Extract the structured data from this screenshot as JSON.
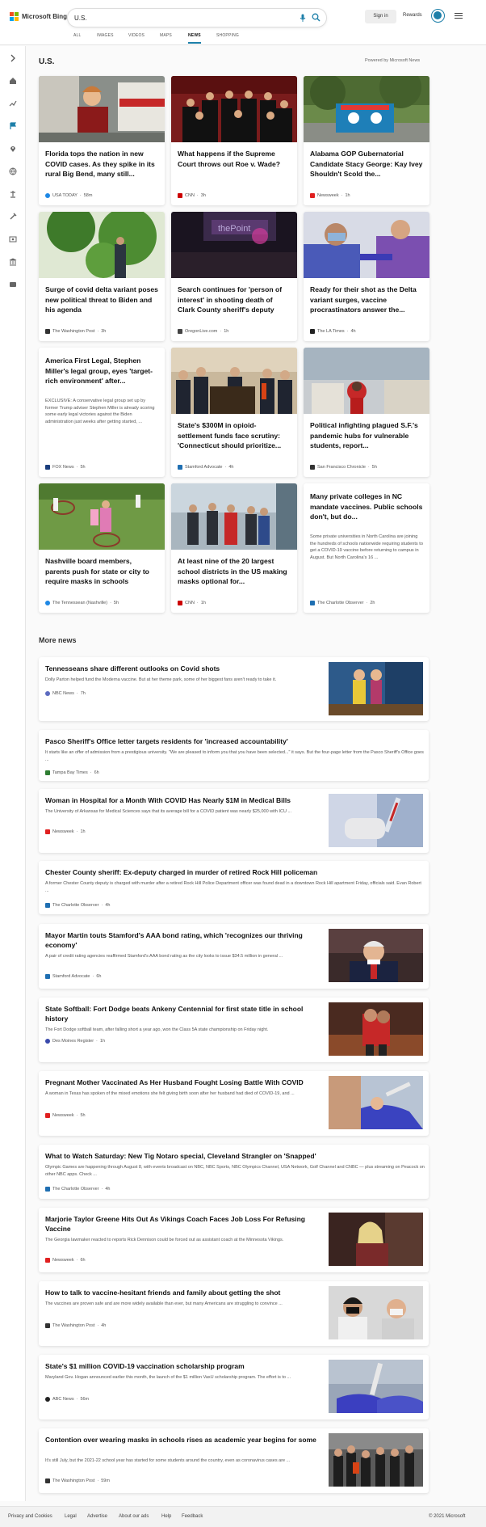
{
  "header": {
    "brand": "Microsoft Bing",
    "search_value": "U.S.",
    "signin": "Sign in",
    "rewards": "Rewards",
    "tabs": [
      "ALL",
      "IMAGES",
      "VIDEOS",
      "MAPS",
      "NEWS",
      "SHOPPING"
    ],
    "active_tab": "NEWS"
  },
  "section": {
    "title": "U.S.",
    "powered": "Powered by Microsoft News"
  },
  "cards": [
    {
      "title": "Florida tops the nation in new COVID cases. As they spike in its rural Big Bend, many still...",
      "source": "USA TODAY",
      "time": "58m",
      "color": "#1e88e5"
    },
    {
      "title": "What happens if the Supreme Court throws out Roe v. Wade?",
      "source": "CNN",
      "time": "3h",
      "color": "#cc0000"
    },
    {
      "title": "Alabama GOP Gubernatorial Candidate Stacy George: Kay Ivey Shouldn't Scold the...",
      "source": "Newsweek",
      "time": "1h",
      "color": "#e02020"
    },
    {
      "title": "Surge of covid delta variant poses new political threat to Biden and his agenda",
      "source": "The Washington Post",
      "time": "3h",
      "color": "#333333"
    },
    {
      "title": "Search continues for 'person of interest' in shooting death of Clark County sheriff's deputy",
      "source": "OregonLive.com",
      "time": "1h",
      "color": "#444444"
    },
    {
      "title": "Ready for their shot as the Delta variant surges, vaccine procrastinators answer the...",
      "source": "The LA Times",
      "time": "4h",
      "color": "#222222"
    },
    {
      "title": "America First Legal, Stephen Miller's legal group, eyes 'target-rich environment' after...",
      "desc": "EXCLUSIVE: A conservative legal group set up by former Trump adviser Stephen Miller is already scoring some early legal victories against the Biden administration just weeks after getting started, ...",
      "source": "FOX News",
      "time": "5h",
      "color": "#1a3d7c"
    },
    {
      "title": "State's $300M in opioid-settlement funds face scrutiny: 'Connecticut should prioritize...",
      "source": "Stamford Advocate",
      "time": "4h",
      "color": "#1f6fb2"
    },
    {
      "title": "Political infighting plagued S.F.'s pandemic hubs for vulnerable students, report...",
      "source": "San Francisco Chronicle",
      "time": "5h",
      "color": "#333333"
    },
    {
      "title": "Nashville board members, parents push for state or city to require masks in schools",
      "source": "The Tennessean (Nashville)",
      "time": "5h",
      "color": "#1e88e5"
    },
    {
      "title": "At least nine of the 20 largest school districts in the US making masks optional for...",
      "source": "CNN",
      "time": "1h",
      "color": "#cc0000"
    },
    {
      "title": "Many private colleges in NC mandate vaccines. Public schools don't, but do...",
      "desc": "Some private universities in North Carolina are joining the hundreds of schools nationwide requiring students to get a COVID-19 vaccine before returning to campus in August. But North Carolina's 16 ...",
      "source": "The Charlotte Observer",
      "time": "2h",
      "color": "#1f6fb2"
    }
  ],
  "more_news": {
    "title": "More news",
    "items": [
      {
        "title": "Tennesseans share different outlooks on Covid shots",
        "desc": "Dolly Parton helped fund the Moderna vaccine. But at her theme park, some of her biggest fans aren't ready to take it.",
        "source": "NBC News",
        "time": "7h",
        "color": "#5c6bc0"
      },
      {
        "title": "Pasco Sheriff's Office letter targets residents for 'increased accountability'",
        "desc": "It starts like an offer of admission from a prestigious university. \"We are pleased to inform you that you have been selected...\" it says. But the four-page letter from the Pasco Sheriff's Office goes ...",
        "source": "Tampa Bay Times",
        "time": "6h",
        "color": "#2e7d32"
      },
      {
        "title": "Woman in Hospital for a Month With COVID Has Nearly $1M in Medical Bills",
        "desc": "The University of Arkansas for Medical Sciences says that its average bill for a COVID patient was nearly $25,000 with ICU ...",
        "source": "Newsweek",
        "time": "1h",
        "color": "#e02020"
      },
      {
        "title": "Chester County sheriff: Ex-deputy charged in murder of retired Rock Hill policeman",
        "desc": "A former Chester County deputy is charged with murder after a retired Rock Hill Police Department officer was found dead in a downtown Rock Hill apartment Friday, officials said. Evan Robert ...",
        "source": "The Charlotte Observer",
        "time": "4h",
        "color": "#1f6fb2"
      },
      {
        "title": "Mayor Martin touts Stamford's AAA bond rating, which 'recognizes our thriving economy'",
        "desc": "A pair of credit rating agencies reaffirmed Stamford's AAA bond rating as the city looks to issue $34.5 million in general ...",
        "source": "Stamford Advocate",
        "time": "6h",
        "color": "#1f6fb2"
      },
      {
        "title": "State Softball: Fort Dodge beats Ankeny Centennial for first state title in school history",
        "desc": "The Fort Dodge softball team, after falling short a year ago, won the Class 5A state championship on Friday night.",
        "source": "Des Moines Register",
        "time": "1h",
        "color": "#3949ab"
      },
      {
        "title": "Pregnant Mother Vaccinated As Her Husband Fought Losing Battle With COVID",
        "desc": "A woman in Texas has spoken of the mixed emotions she felt giving birth soon after her husband had died of COVID-19, and ...",
        "source": "Newsweek",
        "time": "5h",
        "color": "#e02020"
      },
      {
        "title": "What to Watch Saturday: New Tig Notaro special, Cleveland Strangler on 'Snapped'",
        "desc": "Olympic Games are happening through August 8, with events broadcast on NBC, NBC Sports, NBC Olympics Channel, USA Network, Golf Channel and CNBC — plus streaming on Peacock on other NBC apps. Check ...",
        "source": "The Charlotte Observer",
        "time": "4h",
        "color": "#1f6fb2"
      },
      {
        "title": "Marjorie Taylor Greene Hits Out As Vikings Coach Faces Job Loss For Refusing Vaccine",
        "desc": "The Georgia lawmaker reacted to reports Rick Dennison could be forced out as assistant coach at the Minnesota Vikings.",
        "source": "Newsweek",
        "time": "6h",
        "color": "#e02020"
      },
      {
        "title": "How to talk to vaccine-hesitant friends and family about getting the shot",
        "desc": "The vaccines are proven safe and are more widely available than ever, but many Americans are struggling to convince ...",
        "source": "The Washington Post",
        "time": "4h",
        "color": "#333333"
      },
      {
        "title": "State's $1 million COVID-19 vaccination scholarship program",
        "desc": "Maryland Gov. Hogan announced earlier this month, the launch of the $1 million VaxU scholarship program. The effort is to ...",
        "source": "ABC News",
        "time": "56m",
        "color": "#222222"
      },
      {
        "title": "Contention over wearing masks in schools rises as academic year begins for some",
        "desc": "It's still July, but the 2021-22 school year has started for some students around the country, even as coronavirus cases are ...",
        "source": "The Washington Post",
        "time": "59m",
        "color": "#333333"
      }
    ]
  },
  "footer": {
    "links": [
      "Privacy and Cookies",
      "Legal",
      "Advertise",
      "About our ads",
      "Help",
      "Feedback"
    ],
    "copyright": "© 2021 Microsoft"
  }
}
